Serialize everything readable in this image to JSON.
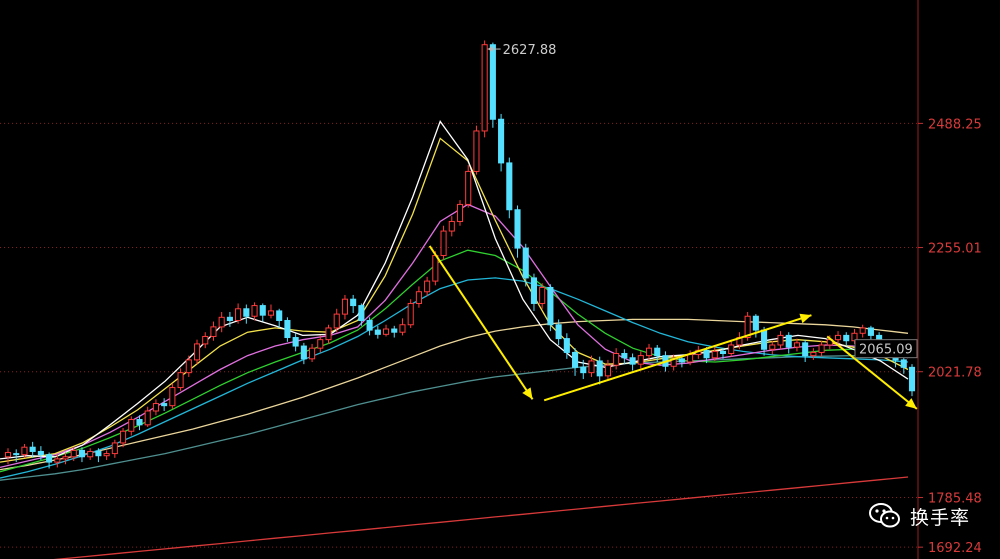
{
  "chart_data": {
    "type": "candlestick",
    "y_scale": "linear",
    "ylim": [
      1670,
      2720
    ],
    "ticks": [
      {
        "value": 2488.25,
        "label": "2488.25"
      },
      {
        "value": 2255.01,
        "label": "2255.01"
      },
      {
        "value": 2021.78,
        "label": "2021.78"
      },
      {
        "value": 1785.48,
        "label": "1785.48"
      },
      {
        "value": 1692.24,
        "label": "1692.24"
      }
    ],
    "annotations": {
      "high": {
        "value": 2627.88,
        "label": "2627.88"
      },
      "last": {
        "value": 2065.09,
        "label": "2065.09"
      }
    },
    "colors": {
      "up": "#ff3b3b",
      "down": "#55e0ff",
      "grid": "#8a1e1e",
      "arrow": "#ffee00",
      "ma5": "#ffffff",
      "ma10": "#f2e14a",
      "ma20": "#e070e0",
      "ma30": "#2fd02f",
      "ma60": "#21b7d9",
      "ma120": "#ead59a",
      "ma250": "#4f8f8f",
      "ma500": "#d83a3a"
    },
    "candles": [
      [
        1862,
        1870,
        1848,
        1878
      ],
      [
        1868,
        1866,
        1852,
        1876
      ],
      [
        1866,
        1880,
        1860,
        1886
      ],
      [
        1880,
        1872,
        1860,
        1890
      ],
      [
        1872,
        1866,
        1856,
        1882
      ],
      [
        1866,
        1852,
        1840,
        1870
      ],
      [
        1852,
        1858,
        1842,
        1866
      ],
      [
        1858,
        1862,
        1848,
        1870
      ],
      [
        1862,
        1874,
        1854,
        1880
      ],
      [
        1874,
        1862,
        1852,
        1880
      ],
      [
        1862,
        1872,
        1856,
        1878
      ],
      [
        1872,
        1864,
        1852,
        1878
      ],
      [
        1864,
        1868,
        1856,
        1874
      ],
      [
        1868,
        1888,
        1860,
        1894
      ],
      [
        1888,
        1910,
        1880,
        1916
      ],
      [
        1910,
        1932,
        1902,
        1938
      ],
      [
        1932,
        1922,
        1912,
        1940
      ],
      [
        1922,
        1948,
        1918,
        1956
      ],
      [
        1948,
        1962,
        1940,
        1970
      ],
      [
        1962,
        1958,
        1948,
        1972
      ],
      [
        1958,
        1992,
        1952,
        2000
      ],
      [
        1992,
        2020,
        1986,
        2028
      ],
      [
        2020,
        2044,
        2012,
        2052
      ],
      [
        2044,
        2074,
        2036,
        2082
      ],
      [
        2074,
        2088,
        2066,
        2096
      ],
      [
        2088,
        2106,
        2080,
        2116
      ],
      [
        2106,
        2124,
        2096,
        2134
      ],
      [
        2124,
        2118,
        2106,
        2134
      ],
      [
        2118,
        2140,
        2112,
        2150
      ],
      [
        2140,
        2126,
        2112,
        2148
      ],
      [
        2126,
        2146,
        2118,
        2152
      ],
      [
        2146,
        2128,
        2116,
        2150
      ],
      [
        2128,
        2136,
        2122,
        2148
      ],
      [
        2136,
        2118,
        2104,
        2140
      ],
      [
        2118,
        2086,
        2078,
        2124
      ],
      [
        2086,
        2070,
        2060,
        2094
      ],
      [
        2070,
        2046,
        2036,
        2076
      ],
      [
        2046,
        2066,
        2040,
        2074
      ],
      [
        2066,
        2082,
        2058,
        2090
      ],
      [
        2082,
        2104,
        2074,
        2110
      ],
      [
        2104,
        2130,
        2096,
        2140
      ],
      [
        2130,
        2158,
        2120,
        2166
      ],
      [
        2158,
        2146,
        2132,
        2166
      ],
      [
        2146,
        2118,
        2108,
        2150
      ],
      [
        2118,
        2100,
        2090,
        2124
      ],
      [
        2100,
        2092,
        2084,
        2108
      ],
      [
        2092,
        2102,
        2088,
        2110
      ],
      [
        2102,
        2096,
        2086,
        2108
      ],
      [
        2096,
        2110,
        2090,
        2122
      ],
      [
        2110,
        2150,
        2104,
        2158
      ],
      [
        2150,
        2172,
        2142,
        2182
      ],
      [
        2172,
        2192,
        2164,
        2200
      ],
      [
        2192,
        2240,
        2184,
        2248
      ],
      [
        2240,
        2286,
        2232,
        2296
      ],
      [
        2286,
        2304,
        2276,
        2314
      ],
      [
        2304,
        2336,
        2296,
        2344
      ],
      [
        2336,
        2398,
        2330,
        2410
      ],
      [
        2398,
        2474,
        2392,
        2484
      ],
      [
        2474,
        2636,
        2462,
        2644
      ],
      [
        2636,
        2496,
        2480,
        2640
      ],
      [
        2496,
        2414,
        2398,
        2506
      ],
      [
        2414,
        2326,
        2310,
        2424
      ],
      [
        2326,
        2254,
        2236,
        2334
      ],
      [
        2254,
        2198,
        2182,
        2262
      ],
      [
        2198,
        2150,
        2136,
        2206
      ],
      [
        2150,
        2180,
        2140,
        2188
      ],
      [
        2180,
        2110,
        2098,
        2186
      ],
      [
        2110,
        2084,
        2072,
        2120
      ],
      [
        2084,
        2058,
        2046,
        2094
      ],
      [
        2058,
        2030,
        2014,
        2066
      ],
      [
        2030,
        2020,
        2008,
        2044
      ],
      [
        2020,
        2042,
        2012,
        2052
      ],
      [
        2042,
        2014,
        1998,
        2050
      ],
      [
        2014,
        2034,
        2006,
        2044
      ],
      [
        2034,
        2056,
        2026,
        2066
      ],
      [
        2056,
        2048,
        2036,
        2064
      ],
      [
        2048,
        2036,
        2024,
        2056
      ],
      [
        2036,
        2052,
        2028,
        2060
      ],
      [
        2052,
        2066,
        2044,
        2074
      ],
      [
        2066,
        2052,
        2040,
        2072
      ],
      [
        2052,
        2032,
        2022,
        2060
      ],
      [
        2032,
        2046,
        2024,
        2054
      ],
      [
        2046,
        2040,
        2030,
        2052
      ],
      [
        2040,
        2054,
        2034,
        2062
      ],
      [
        2054,
        2062,
        2046,
        2070
      ],
      [
        2062,
        2048,
        2038,
        2068
      ],
      [
        2048,
        2060,
        2042,
        2070
      ],
      [
        2060,
        2056,
        2046,
        2066
      ],
      [
        2056,
        2072,
        2050,
        2082
      ],
      [
        2072,
        2086,
        2064,
        2096
      ],
      [
        2086,
        2126,
        2080,
        2134
      ],
      [
        2126,
        2100,
        2086,
        2130
      ],
      [
        2100,
        2064,
        2052,
        2106
      ],
      [
        2064,
        2072,
        2054,
        2080
      ],
      [
        2072,
        2090,
        2064,
        2098
      ],
      [
        2090,
        2068,
        2056,
        2096
      ],
      [
        2068,
        2076,
        2060,
        2084
      ],
      [
        2076,
        2052,
        2040,
        2082
      ],
      [
        2052,
        2058,
        2044,
        2066
      ],
      [
        2058,
        2072,
        2050,
        2080
      ],
      [
        2072,
        2082,
        2064,
        2090
      ],
      [
        2082,
        2090,
        2074,
        2098
      ],
      [
        2090,
        2080,
        2070,
        2096
      ],
      [
        2080,
        2094,
        2074,
        2102
      ],
      [
        2094,
        2104,
        2086,
        2110
      ],
      [
        2104,
        2090,
        2078,
        2108
      ],
      [
        2090,
        2070,
        2060,
        2096
      ],
      [
        2070,
        2058,
        2048,
        2076
      ],
      [
        2058,
        2044,
        2030,
        2062
      ],
      [
        2044,
        2030,
        2018,
        2050
      ],
      [
        2030,
        1986,
        1976,
        2036
      ]
    ],
    "moving_averages": [
      {
        "key": "ma500",
        "values": [
          1660,
          1664,
          1669,
          1674,
          1679,
          1684,
          1689,
          1694,
          1699,
          1704,
          1709,
          1714,
          1719,
          1724,
          1729,
          1734,
          1739,
          1744,
          1749,
          1754,
          1759,
          1764,
          1769,
          1774,
          1779,
          1784,
          1789,
          1794,
          1799,
          1804,
          1809,
          1814,
          1819,
          1824
        ]
      },
      {
        "key": "ma250",
        "values": [
          1818,
          1824,
          1830,
          1838,
          1848,
          1858,
          1868,
          1880,
          1892,
          1904,
          1918,
          1932,
          1946,
          1960,
          1972,
          1984,
          1994,
          2004,
          2012,
          2018,
          2024,
          2030,
          2034,
          2038,
          2040,
          2042,
          2044,
          2046,
          2048,
          2050,
          2051,
          2052,
          2053,
          2054
        ]
      },
      {
        "key": "ma120",
        "values": [
          1838,
          1846,
          1856,
          1866,
          1878,
          1890,
          1902,
          1914,
          1928,
          1942,
          1958,
          1974,
          1992,
          2010,
          2030,
          2050,
          2070,
          2086,
          2098,
          2106,
          2112,
          2116,
          2118,
          2120,
          2120,
          2120,
          2118,
          2116,
          2114,
          2112,
          2110,
          2106,
          2100,
          2094
        ]
      },
      {
        "key": "ma60",
        "values": [
          1822,
          1834,
          1848,
          1864,
          1882,
          1904,
          1928,
          1952,
          1976,
          2000,
          2022,
          2044,
          2064,
          2088,
          2118,
          2150,
          2178,
          2194,
          2198,
          2192,
          2178,
          2158,
          2136,
          2114,
          2094,
          2078,
          2068,
          2060,
          2054,
          2050,
          2048,
          2046,
          2044,
          2040
        ]
      },
      {
        "key": "ma30",
        "values": [
          1834,
          1848,
          1862,
          1878,
          1898,
          1920,
          1944,
          1970,
          1996,
          2020,
          2040,
          2058,
          2076,
          2100,
          2140,
          2186,
          2230,
          2250,
          2240,
          2212,
          2172,
          2130,
          2094,
          2066,
          2050,
          2042,
          2040,
          2044,
          2050,
          2056,
          2062,
          2064,
          2060,
          2050
        ]
      },
      {
        "key": "ma20",
        "values": [
          1842,
          1854,
          1866,
          1884,
          1908,
          1936,
          1966,
          1996,
          2026,
          2052,
          2070,
          2082,
          2090,
          2106,
          2156,
          2226,
          2304,
          2336,
          2314,
          2256,
          2182,
          2110,
          2064,
          2040,
          2034,
          2038,
          2046,
          2054,
          2062,
          2068,
          2072,
          2070,
          2062,
          2048
        ]
      },
      {
        "key": "ma10",
        "values": [
          1852,
          1860,
          1868,
          1888,
          1918,
          1950,
          1990,
          2030,
          2070,
          2096,
          2104,
          2098,
          2096,
          2118,
          2202,
          2318,
          2460,
          2418,
          2306,
          2200,
          2110,
          2058,
          2036,
          2038,
          2046,
          2054,
          2062,
          2070,
          2078,
          2082,
          2078,
          2068,
          2052,
          2026
        ]
      },
      {
        "key": "ma5",
        "values": [
          1858,
          1864,
          1862,
          1884,
          1922,
          1962,
          2004,
          2054,
          2106,
          2124,
          2108,
          2090,
          2092,
          2128,
          2226,
          2350,
          2492,
          2420,
          2272,
          2158,
          2082,
          2040,
          2030,
          2040,
          2050,
          2054,
          2060,
          2072,
          2082,
          2090,
          2084,
          2064,
          2042,
          2008
        ]
      }
    ],
    "trend_arrows": [
      {
        "x0": 0.508,
        "y0": 2258,
        "x1": 0.632,
        "y1": 1970
      },
      {
        "x0": 0.646,
        "y0": 1968,
        "x1": 0.968,
        "y1": 2128
      },
      {
        "x0": 0.987,
        "y0": 2088,
        "x1": 1.095,
        "y1": 1952
      }
    ]
  },
  "watermark": {
    "text": "换手率",
    "icon": "wechat-icon"
  }
}
